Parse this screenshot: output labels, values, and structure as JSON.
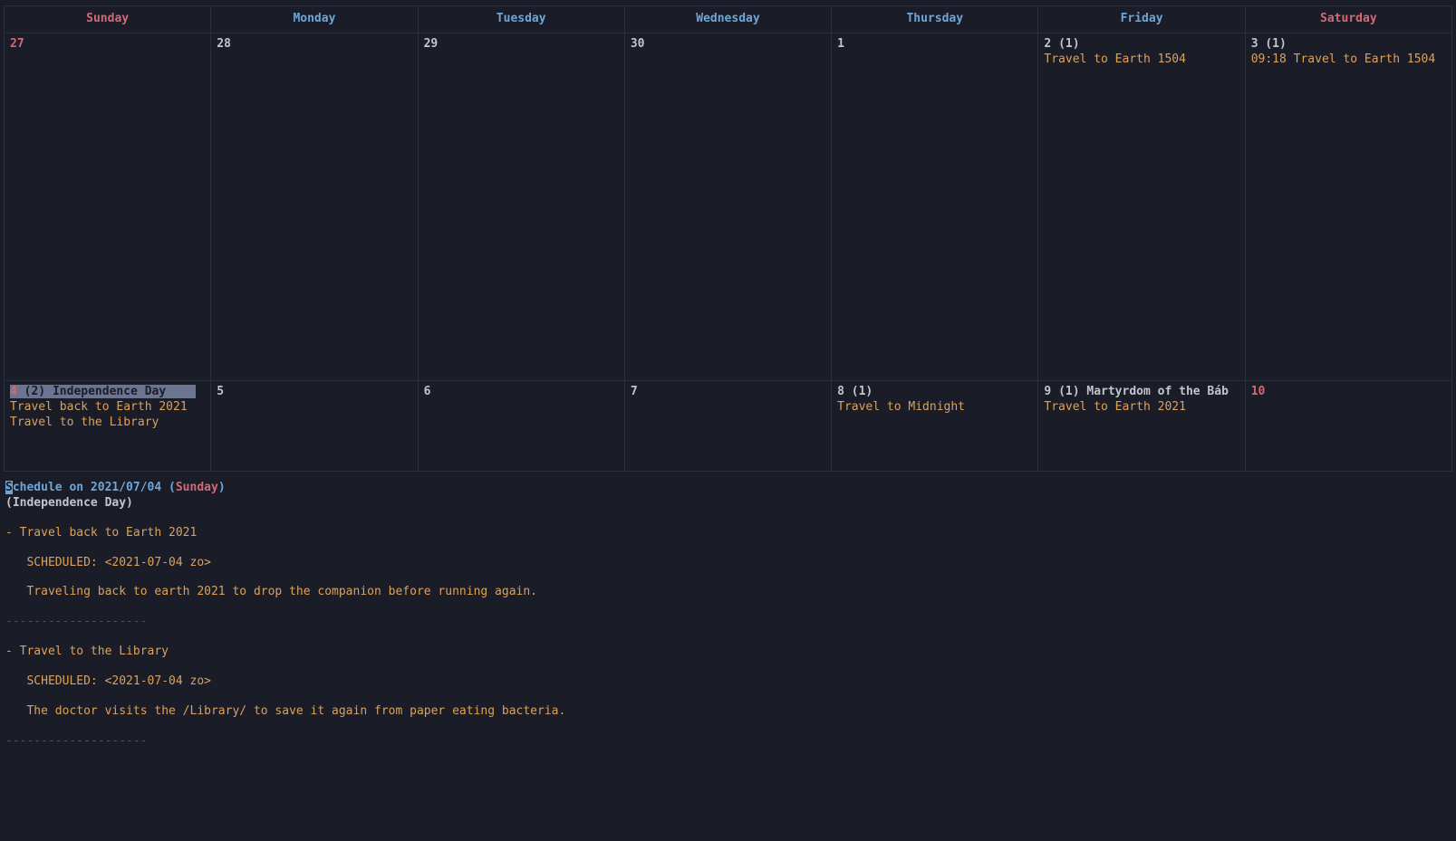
{
  "headers": {
    "sun": "Sunday",
    "mon": "Monday",
    "tue": "Tuesday",
    "wed": "Wednesday",
    "thu": "Thursday",
    "fri": "Friday",
    "sat": "Saturday"
  },
  "row1": {
    "sun": {
      "num": "27"
    },
    "mon": {
      "num": "28"
    },
    "tue": {
      "num": "29"
    },
    "wed": {
      "num": "30"
    },
    "thu": {
      "num": "1"
    },
    "fri": {
      "num": "2",
      "count": "(1)",
      "events": [
        "Travel to Earth 1504"
      ]
    },
    "sat": {
      "num": "3",
      "count": "(1)",
      "events": [
        "09:18 Travel to Earth 1504"
      ]
    }
  },
  "row2": {
    "sun": {
      "num": "4",
      "count": "(2)",
      "holiday": "Independence Day",
      "events": [
        "Travel back to Earth 2021",
        "Travel to the Library"
      ]
    },
    "mon": {
      "num": "5"
    },
    "tue": {
      "num": "6"
    },
    "wed": {
      "num": "7"
    },
    "thu": {
      "num": "8",
      "count": "(1)",
      "events": [
        "Travel to Midnight"
      ]
    },
    "fri": {
      "num": "9",
      "count": "(1)",
      "holiday": "Martyrdom of the Báb",
      "events": [
        "Travel to Earth 2021"
      ]
    },
    "sat": {
      "num": "10"
    }
  },
  "schedule": {
    "title_prefix": "Schedule on ",
    "title_prefix_initial": "S",
    "title_prefix_rest": "chedule on ",
    "date": "2021/07/04",
    "paren_open": " (",
    "dayname": "Sunday",
    "paren_close": ")",
    "holiday": "(Independence Day)",
    "items": [
      {
        "title": "- Travel back to Earth 2021",
        "scheduled": "   SCHEDULED: <2021-07-04 zo>",
        "desc": "   Traveling back to earth 2021 to drop the companion before running again."
      },
      {
        "title": "- Travel to the Library",
        "scheduled": "   SCHEDULED: <2021-07-04 zo>",
        "desc": "   The doctor visits the /Library/ to save it again from paper eating bacteria."
      }
    ],
    "divider": "--------------------"
  }
}
